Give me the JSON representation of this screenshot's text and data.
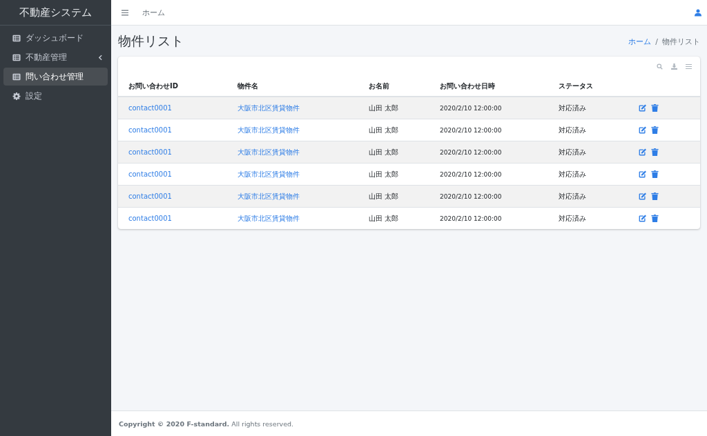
{
  "sidebar": {
    "brand": "不動産システム",
    "items": [
      {
        "label": "ダッシュボード",
        "kind": "page",
        "selected": false
      },
      {
        "label": "不動産管理",
        "kind": "group",
        "selected": false
      },
      {
        "label": "問い合わせ管理",
        "kind": "page",
        "selected": true
      },
      {
        "label": "設定",
        "kind": "settings",
        "selected": false
      }
    ]
  },
  "topbar": {
    "link": "ホーム"
  },
  "page": {
    "title": "物件リスト",
    "breadcrumb_separator": "/",
    "breadcrumb": [
      {
        "label": "ホーム",
        "kind": "link"
      },
      {
        "label": "物件リスト",
        "kind": "current"
      }
    ]
  },
  "table": {
    "columns": [
      "お問い合わせID",
      "物件名",
      "お名前",
      "お問い合わせ日時",
      "ステータス"
    ],
    "rows": [
      [
        "contact0001",
        "大阪市北区賃貸物件",
        "山田 太郎",
        "2020/2/10 12:00:00",
        "対応済み"
      ],
      [
        "contact0001",
        "大阪市北区賃貸物件",
        "山田 太郎",
        "2020/2/10 12:00:00",
        "対応済み"
      ],
      [
        "contact0001",
        "大阪市北区賃貸物件",
        "山田 太郎",
        "2020/2/10 12:00:00",
        "対応済み"
      ],
      [
        "contact0001",
        "大阪市北区賃貸物件",
        "山田 太郎",
        "2020/2/10 12:00:00",
        "対応済み"
      ],
      [
        "contact0001",
        "大阪市北区賃貸物件",
        "山田 太郎",
        "2020/2/10 12:00:00",
        "対応済み"
      ],
      [
        "contact0001",
        "大阪市北区賃貸物件",
        "山田 太郎",
        "2020/2/10 12:00:00",
        "対応済み"
      ]
    ]
  },
  "footer": "**Copyright © 2020 F-standard.** All rights reserved."
}
